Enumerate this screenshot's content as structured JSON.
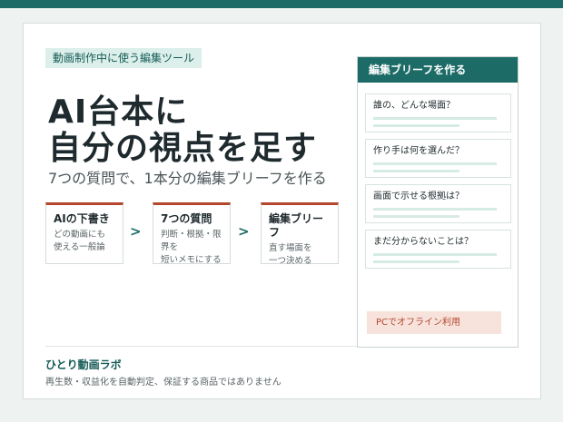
{
  "tag": "動画制作中に使う編集ツール",
  "headline": {
    "line1": "AI台本に",
    "line2": "自分の視点を足す"
  },
  "subline": "7つの質問で、1本分の編集ブリーフを作る",
  "steps": [
    {
      "title": "AIの下書き",
      "desc": "どの動画にも\n使える一般論"
    },
    {
      "title": "7つの質問",
      "desc": "判断・根拠・限界を\n短いメモにする"
    },
    {
      "title": "編集ブリーフ",
      "desc": "直す場面を\n一つ決める"
    }
  ],
  "arrow": ">",
  "panel": {
    "title": "編集ブリーフを作る",
    "questions": [
      "誰の、どんな場面？",
      "作り手は何を選んだ？",
      "画面で示せる根拠は？",
      "まだ分からないことは？"
    ],
    "offline": "PCでオフライン利用"
  },
  "footer": {
    "brand": "ひとり動画ラボ",
    "note": "再生数・収益化を自動判定、保証する商品ではありません"
  },
  "colors": {
    "brand": "#1c6b67",
    "accent": "#b3472d",
    "tag_bg": "#dcefea",
    "offline_bg": "#f8e3dc"
  }
}
